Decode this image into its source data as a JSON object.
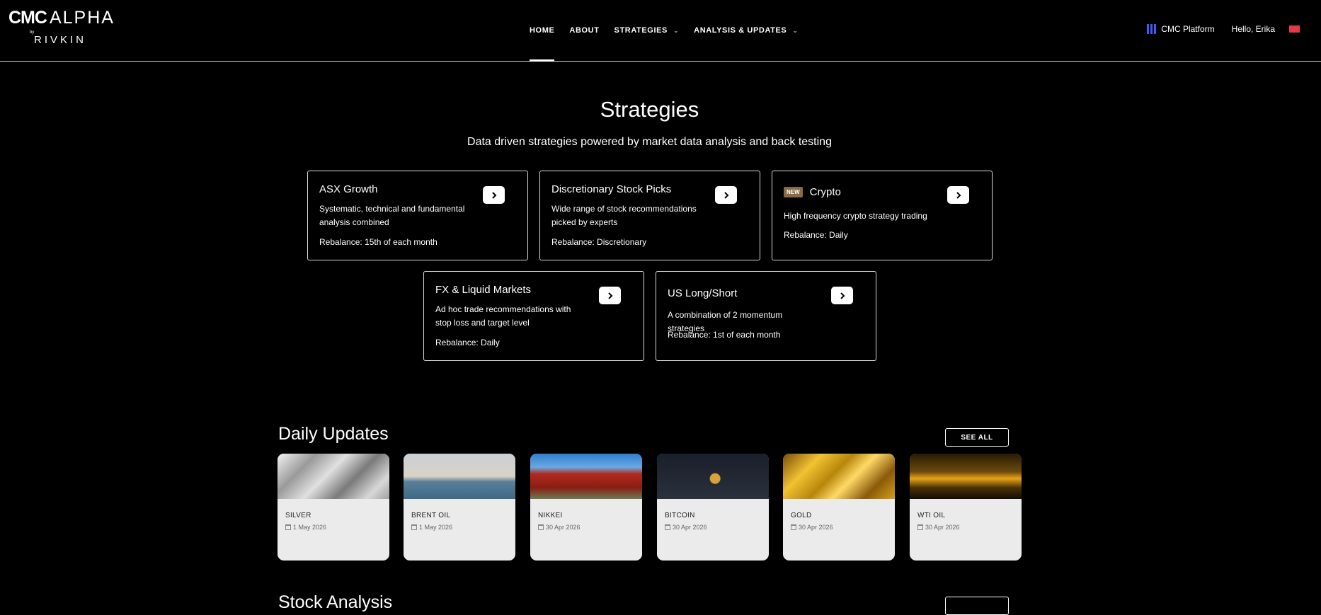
{
  "header": {
    "logo": {
      "brand": "CMC",
      "product": "ALPHA",
      "by": "by",
      "partner": "RIVKIN"
    },
    "nav": [
      {
        "label": "HOME",
        "active": true,
        "dropdown": false
      },
      {
        "label": "ABOUT",
        "active": false,
        "dropdown": false
      },
      {
        "label": "STRATEGIES",
        "active": false,
        "dropdown": true
      },
      {
        "label": "ANALYSIS & UPDATES",
        "active": false,
        "dropdown": true
      }
    ],
    "platform_label": "CMC Platform",
    "greeting": "Hello, Erika",
    "flag_color": "#e63946",
    "platform_icon_color": "#3d5afe"
  },
  "strategies": {
    "title": "Strategies",
    "subtitle": "Data driven strategies powered by market data analysis and back testing",
    "cards": [
      {
        "title": "ASX Growth",
        "badge": "",
        "description": "Systematic, technical and fundamental analysis combined",
        "rebalance": "Rebalance: 15th of each month"
      },
      {
        "title": "Discretionary Stock Picks",
        "badge": "",
        "description": "Wide range of stock recommendations picked by experts",
        "rebalance": "Rebalance: Discretionary"
      },
      {
        "title": "Crypto",
        "badge": "NEW",
        "description": "High frequency crypto strategy trading",
        "rebalance": "Rebalance: Daily"
      },
      {
        "title": "FX & Liquid Markets",
        "badge": "",
        "description": "Ad hoc trade recommendations with stop loss and target level",
        "rebalance": "Rebalance: Daily"
      },
      {
        "title": "US Long/Short",
        "badge": "",
        "description": "A combination of 2 momentum strategies",
        "rebalance": "Rebalance: 1st of each month"
      }
    ]
  },
  "daily_updates": {
    "title": "Daily Updates",
    "see_all": "SEE ALL",
    "items": [
      {
        "name": "SILVER",
        "date": "1 May 2026",
        "image": "silver-bars-image"
      },
      {
        "name": "BRENT OIL",
        "date": "1 May 2026",
        "image": "oil-rig-image"
      },
      {
        "name": "NIKKEI",
        "date": "30 Apr 2026",
        "image": "japanese-temple-image"
      },
      {
        "name": "BITCOIN",
        "date": "30 Apr 2026",
        "image": "bitcoin-coin-image"
      },
      {
        "name": "GOLD",
        "date": "30 Apr 2026",
        "image": "gold-bars-image"
      },
      {
        "name": "WTI OIL",
        "date": "30 Apr 2026",
        "image": "oil-pump-sunset-image"
      }
    ]
  },
  "stock_analysis": {
    "title": "Stock Analysis"
  }
}
